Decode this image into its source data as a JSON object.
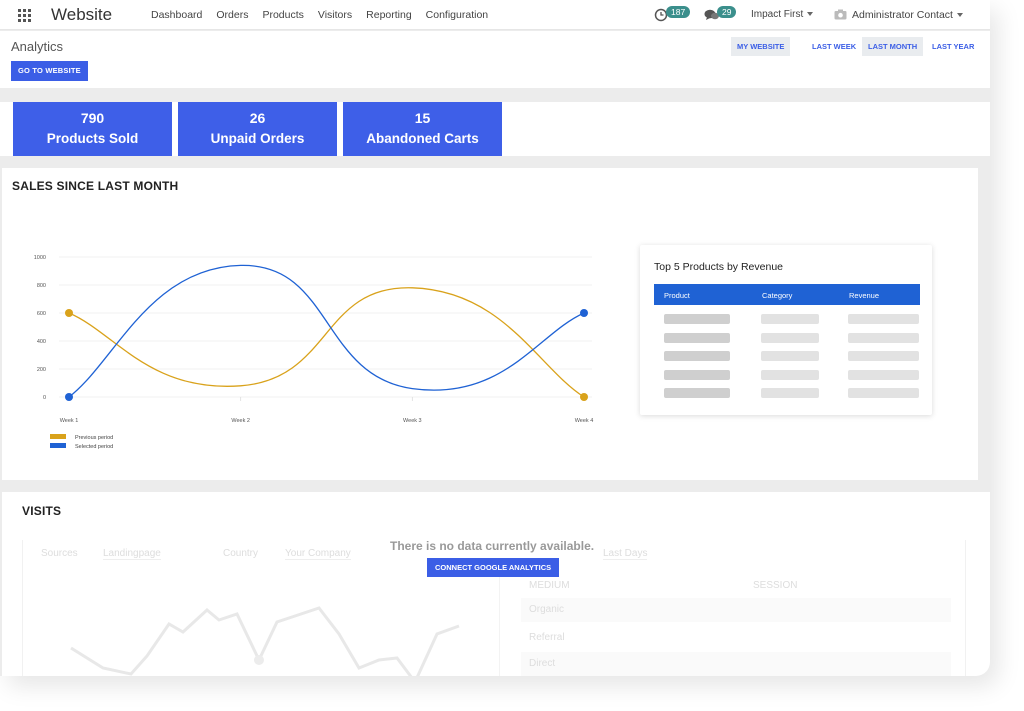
{
  "navbar": {
    "brand": "Website",
    "menu": [
      "Dashboard",
      "Orders",
      "Products",
      "Visitors",
      "Reporting",
      "Configuration"
    ],
    "activities_count": "187",
    "messages_count": "29",
    "company": "Impact First",
    "user": "Administrator Contact"
  },
  "control": {
    "title": "Analytics",
    "goto_label": "GO TO WEBSITE",
    "my_website_label": "MY WEBSITE",
    "periods": [
      "LAST WEEK",
      "LAST MONTH",
      "LAST YEAR"
    ],
    "active_period": "LAST MONTH"
  },
  "kpis": [
    {
      "value": "790",
      "label": "Products Sold"
    },
    {
      "value": "26",
      "label": "Unpaid Orders"
    },
    {
      "value": "15",
      "label": "Abandoned Carts"
    }
  ],
  "sales": {
    "title": "SALES SINCE LAST MONTH"
  },
  "chart_data": {
    "type": "line",
    "categories": [
      "Week 1",
      "Week 2",
      "Week 3",
      "Week 4"
    ],
    "y_ticks": [
      "0",
      "200",
      "400",
      "600",
      "800",
      "1000"
    ],
    "ylim": [
      0,
      1000
    ],
    "series": [
      {
        "name": "Previous period",
        "color": "#d9a21b",
        "values": [
          600,
          80,
          780,
          0
        ]
      },
      {
        "name": "Selected period",
        "color": "#1f62d4",
        "values": [
          0,
          940,
          60,
          600
        ]
      }
    ],
    "grid": true,
    "legend": "bottom-left"
  },
  "top_products": {
    "title": "Top 5 Products by Revenue",
    "columns": [
      "Product",
      "Category",
      "Revenue"
    ]
  },
  "visits": {
    "title": "VISITS",
    "no_data": "There is no data currently available.",
    "connect_label": "CONNECT GOOGLE ANALYTICS",
    "ghost_labels": [
      "Sources",
      "Landingpage",
      "Country",
      "Your Company",
      "Last Days",
      "MEDIUM",
      "SESSION",
      "Organic",
      "Referral",
      "Direct"
    ]
  }
}
